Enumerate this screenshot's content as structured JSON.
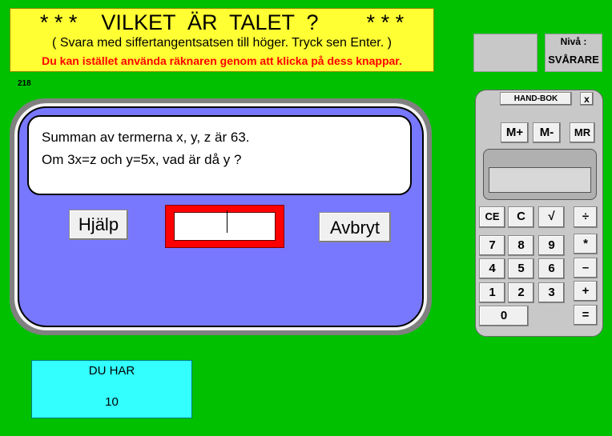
{
  "header": {
    "title": "* * *    VILKET  ÄR  TALET  ?        * * *",
    "subtitle": "( Svara med siffertangentsatsen till höger. Tryck sen Enter. )",
    "hint": "Du kan istället använda räknaren genom att klicka på dess knappar."
  },
  "level": {
    "label": "Nivå :",
    "value": "SVÅRARE"
  },
  "counter": "218",
  "question": {
    "line1": "Summan av termerna x, y, z är 63.",
    "line2": "Om 3x=z och y=5x, vad är då y ?"
  },
  "buttons": {
    "help": "Hjälp",
    "cancel": "Avbryt"
  },
  "answer": {
    "value": ""
  },
  "score": {
    "label": "DU HAR",
    "value": "10"
  },
  "calculator": {
    "handbook": "HAND-BOK",
    "close": "x",
    "mplus": "M+",
    "mminus": "M-",
    "mr": "MR",
    "ce": "CE",
    "c": "C",
    "sqrt": "√",
    "divide": "÷",
    "multiply": "*",
    "minus": "–",
    "plus": "+",
    "equals": "=",
    "d7": "7",
    "d8": "8",
    "d9": "9",
    "d4": "4",
    "d5": "5",
    "d6": "6",
    "d1": "1",
    "d2": "2",
    "d3": "3",
    "d0": "0"
  },
  "colors": {
    "background": "#00c000",
    "banner": "#ffff33",
    "hint_text": "#ff0000",
    "panel": "#7878ff",
    "answer_frame": "#ff0000",
    "score_box": "#33ffff"
  }
}
